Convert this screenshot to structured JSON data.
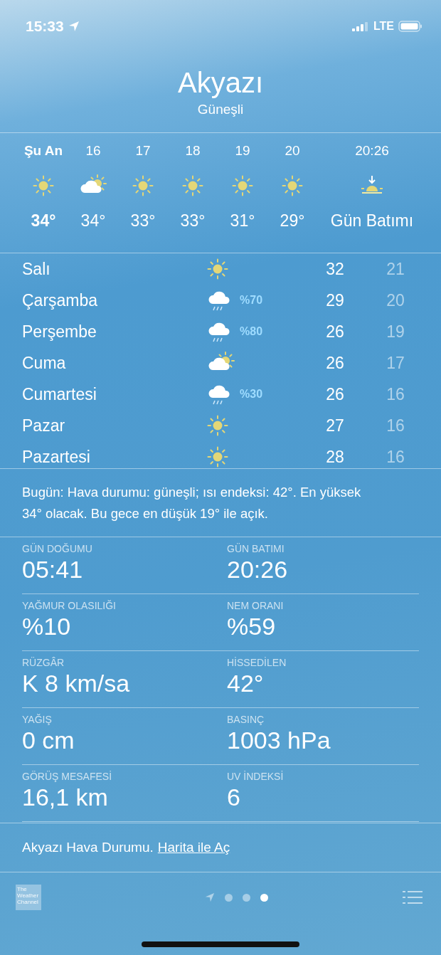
{
  "status_bar": {
    "time": "15:33",
    "network": "LTE"
  },
  "header": {
    "city": "Akyazı",
    "condition": "Güneşli"
  },
  "hourly": [
    {
      "label": "Şu An",
      "kind": "sun",
      "temp": "34°",
      "now": true
    },
    {
      "label": "16",
      "kind": "partly-cloudy",
      "temp": "34°",
      "now": false
    },
    {
      "label": "17",
      "kind": "sun",
      "temp": "33°",
      "now": false
    },
    {
      "label": "18",
      "kind": "sun",
      "temp": "33°",
      "now": false
    },
    {
      "label": "19",
      "kind": "sun",
      "temp": "31°",
      "now": false
    },
    {
      "label": "20",
      "kind": "sun",
      "temp": "29°",
      "now": false
    },
    {
      "label": "20:26",
      "kind": "sunset",
      "temp": "Gün Batımı",
      "now": false
    }
  ],
  "daily": [
    {
      "day": "Salı",
      "kind": "sun",
      "high": "32",
      "low": "21"
    },
    {
      "day": "Çarşamba",
      "kind": "rain",
      "chance": "%70",
      "high": "29",
      "low": "20"
    },
    {
      "day": "Perşembe",
      "kind": "rain",
      "chance": "%80",
      "high": "26",
      "low": "19"
    },
    {
      "day": "Cuma",
      "kind": "partly-cloudy",
      "high": "26",
      "low": "17"
    },
    {
      "day": "Cumartesi",
      "kind": "rain",
      "chance": "%30",
      "high": "26",
      "low": "16"
    },
    {
      "day": "Pazar",
      "kind": "sun",
      "high": "27",
      "low": "16"
    },
    {
      "day": "Pazartesi",
      "kind": "sun",
      "high": "28",
      "low": "16"
    }
  ],
  "summary": "Bugün: Hava durumu: güneşli; ısı endeksi: 42°. En yüksek 34° olacak. Bu gece en düşük 19° ile açık.",
  "details": [
    [
      {
        "label": "GÜN DOĞUMU",
        "value": "05:41"
      },
      {
        "label": "GÜN BATIMI",
        "value": "20:26"
      }
    ],
    [
      {
        "label": "YAĞMUR OLASILIĞI",
        "value": "%10"
      },
      {
        "label": "NEM ORANI",
        "value": "%59"
      }
    ],
    [
      {
        "label": "RÜZGÂR",
        "value": "K 8 km/sa"
      },
      {
        "label": "HİSSEDİLEN",
        "value": "42°"
      }
    ],
    [
      {
        "label": "YAĞIŞ",
        "value": "0 cm"
      },
      {
        "label": "BASINÇ",
        "value": "1003 hPa"
      }
    ],
    [
      {
        "label": "GÖRÜŞ MESAFESİ",
        "value": "16,1 km"
      },
      {
        "label": "UV İNDEKSİ",
        "value": "6"
      }
    ]
  ],
  "footer": {
    "text": "Akyazı Hava Durumu.",
    "link": "Harita ile Aç"
  },
  "bottom_bar": {
    "logo": "The Weather Channel",
    "pages": [
      {
        "kind": "location",
        "selected": false
      },
      {
        "kind": "dot",
        "selected": false
      },
      {
        "kind": "dot",
        "selected": false
      },
      {
        "kind": "dot",
        "selected": true
      }
    ]
  }
}
